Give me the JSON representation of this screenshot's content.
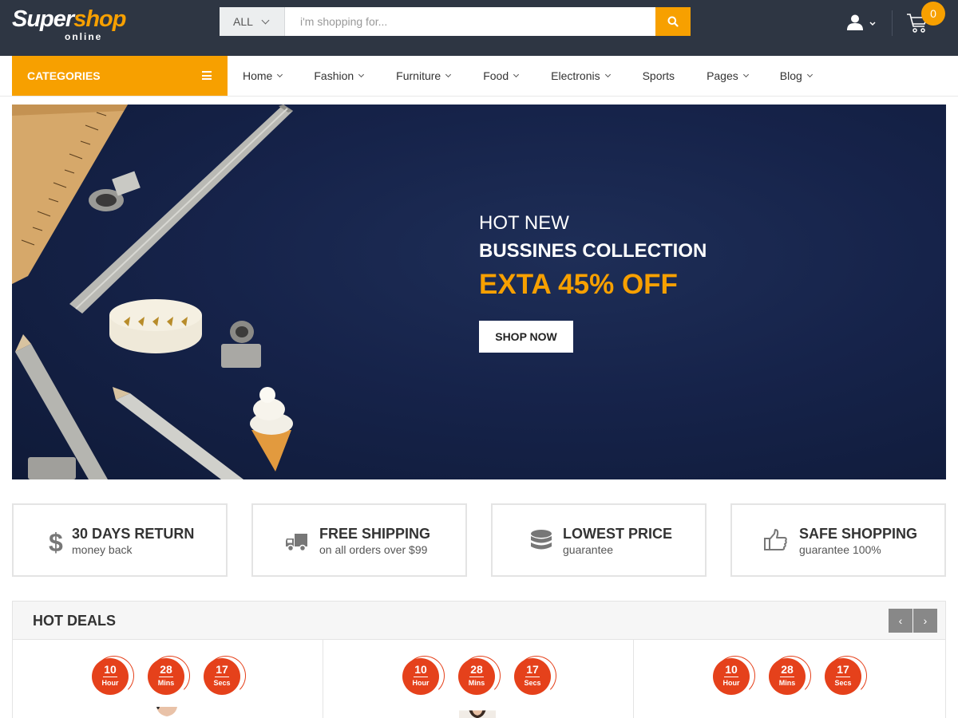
{
  "header": {
    "logo": {
      "brand_primary": "Super",
      "brand_accent": "shop",
      "tagline": "online"
    },
    "search": {
      "category": "ALL",
      "placeholder": "i'm shopping for...",
      "value": ""
    },
    "cart": {
      "count": "0"
    },
    "icons": [
      "search-icon",
      "user-icon",
      "cart-icon"
    ]
  },
  "nav": {
    "categories_label": "CATEGORIES",
    "items": [
      {
        "label": "Home",
        "dropdown": true
      },
      {
        "label": "Fashion",
        "dropdown": true
      },
      {
        "label": "Furniture",
        "dropdown": true
      },
      {
        "label": "Food",
        "dropdown": true
      },
      {
        "label": "Electronis",
        "dropdown": true
      },
      {
        "label": "Sports",
        "dropdown": false
      },
      {
        "label": "Pages",
        "dropdown": true
      },
      {
        "label": "Blog",
        "dropdown": true
      }
    ]
  },
  "hero": {
    "line1": "HOT NEW",
    "line2": "BUSSINES COLLECTION",
    "line3": "EXTA 45% OFF",
    "cta": "SHOP NOW"
  },
  "features": [
    {
      "icon": "dollar-icon",
      "title": "30 DAYS RETURN",
      "subtitle": "money back"
    },
    {
      "icon": "truck-icon",
      "title": "FREE SHIPPING",
      "subtitle": "on all orders over $99"
    },
    {
      "icon": "database-icon",
      "title": "LOWEST PRICE",
      "subtitle": "guarantee"
    },
    {
      "icon": "thumbs-up-icon",
      "title": "SAFE SHOPPING",
      "subtitle": "guarantee 100%"
    }
  ],
  "hot_deals": {
    "title": "HOT DEALS",
    "prev_label": "‹",
    "next_label": "›",
    "timers": [
      {
        "hour": "10",
        "hour_label": "Hour",
        "mins": "28",
        "mins_label": "Mins",
        "secs": "17",
        "secs_label": "Secs"
      },
      {
        "hour": "10",
        "hour_label": "Hour",
        "mins": "28",
        "mins_label": "Mins",
        "secs": "17",
        "secs_label": "Secs"
      },
      {
        "hour": "10",
        "hour_label": "Hour",
        "mins": "28",
        "mins_label": "Mins",
        "secs": "17",
        "secs_label": "Secs"
      }
    ]
  },
  "colors": {
    "header_bg": "#2e3643",
    "accent": "#f7a000",
    "timer_red": "#e5411b",
    "hero_bg": "#16234a"
  }
}
